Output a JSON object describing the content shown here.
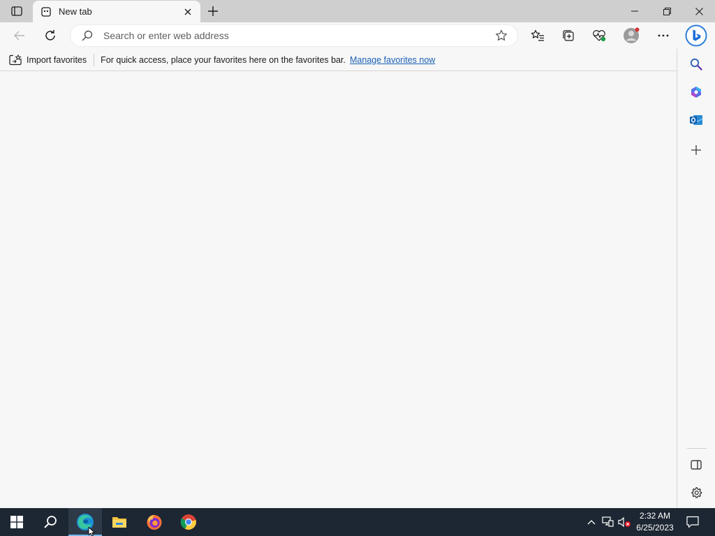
{
  "tab": {
    "title": "New tab",
    "favicon": "new-tab-page-icon"
  },
  "address_bar": {
    "placeholder": "Search or enter web address",
    "value": ""
  },
  "favorites_bar": {
    "import_label": "Import favorites",
    "message": "For quick access, place your favorites here on the favorites bar.",
    "link_label": "Manage favorites now"
  },
  "toolbar_icons": [
    "back-icon",
    "refresh-icon",
    "favorites-icon",
    "collections-icon",
    "browser-essentials-icon",
    "profile-icon",
    "settings-more-icon",
    "bing-chat-icon"
  ],
  "sidebar_icons": [
    "search-icon",
    "microsoft-365-icon",
    "outlook-icon",
    "add-icon",
    "hide-sidebar-icon",
    "settings-icon"
  ],
  "taskbar": {
    "apps": [
      "start-icon",
      "search-icon",
      "edge-icon",
      "file-explorer-icon",
      "firefox-icon",
      "chrome-icon"
    ],
    "time": "2:32 AM",
    "date": "6/25/2023"
  },
  "colors": {
    "taskbar_bg": "#1d2733",
    "tab_strip_bg": "#cfcfcf",
    "page_bg": "#f7f7f7",
    "link": "#1a5fb4",
    "accent": "#76b9ed"
  }
}
